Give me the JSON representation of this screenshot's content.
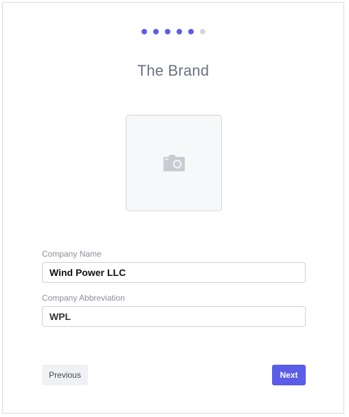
{
  "wizard": {
    "total_steps": 6,
    "current_step": 5,
    "title": "The Brand"
  },
  "logo": {
    "icon": "camera-icon"
  },
  "company_name": {
    "label": "Company Name",
    "value": "Wind Power LLC"
  },
  "company_abbreviation": {
    "label": "Company Abbreviation",
    "value": "WPL"
  },
  "buttons": {
    "previous_label": "Previous",
    "next_label": "Next"
  },
  "colors": {
    "accent": "#5b5ce8",
    "inactive_dot": "#d3d6dc"
  }
}
